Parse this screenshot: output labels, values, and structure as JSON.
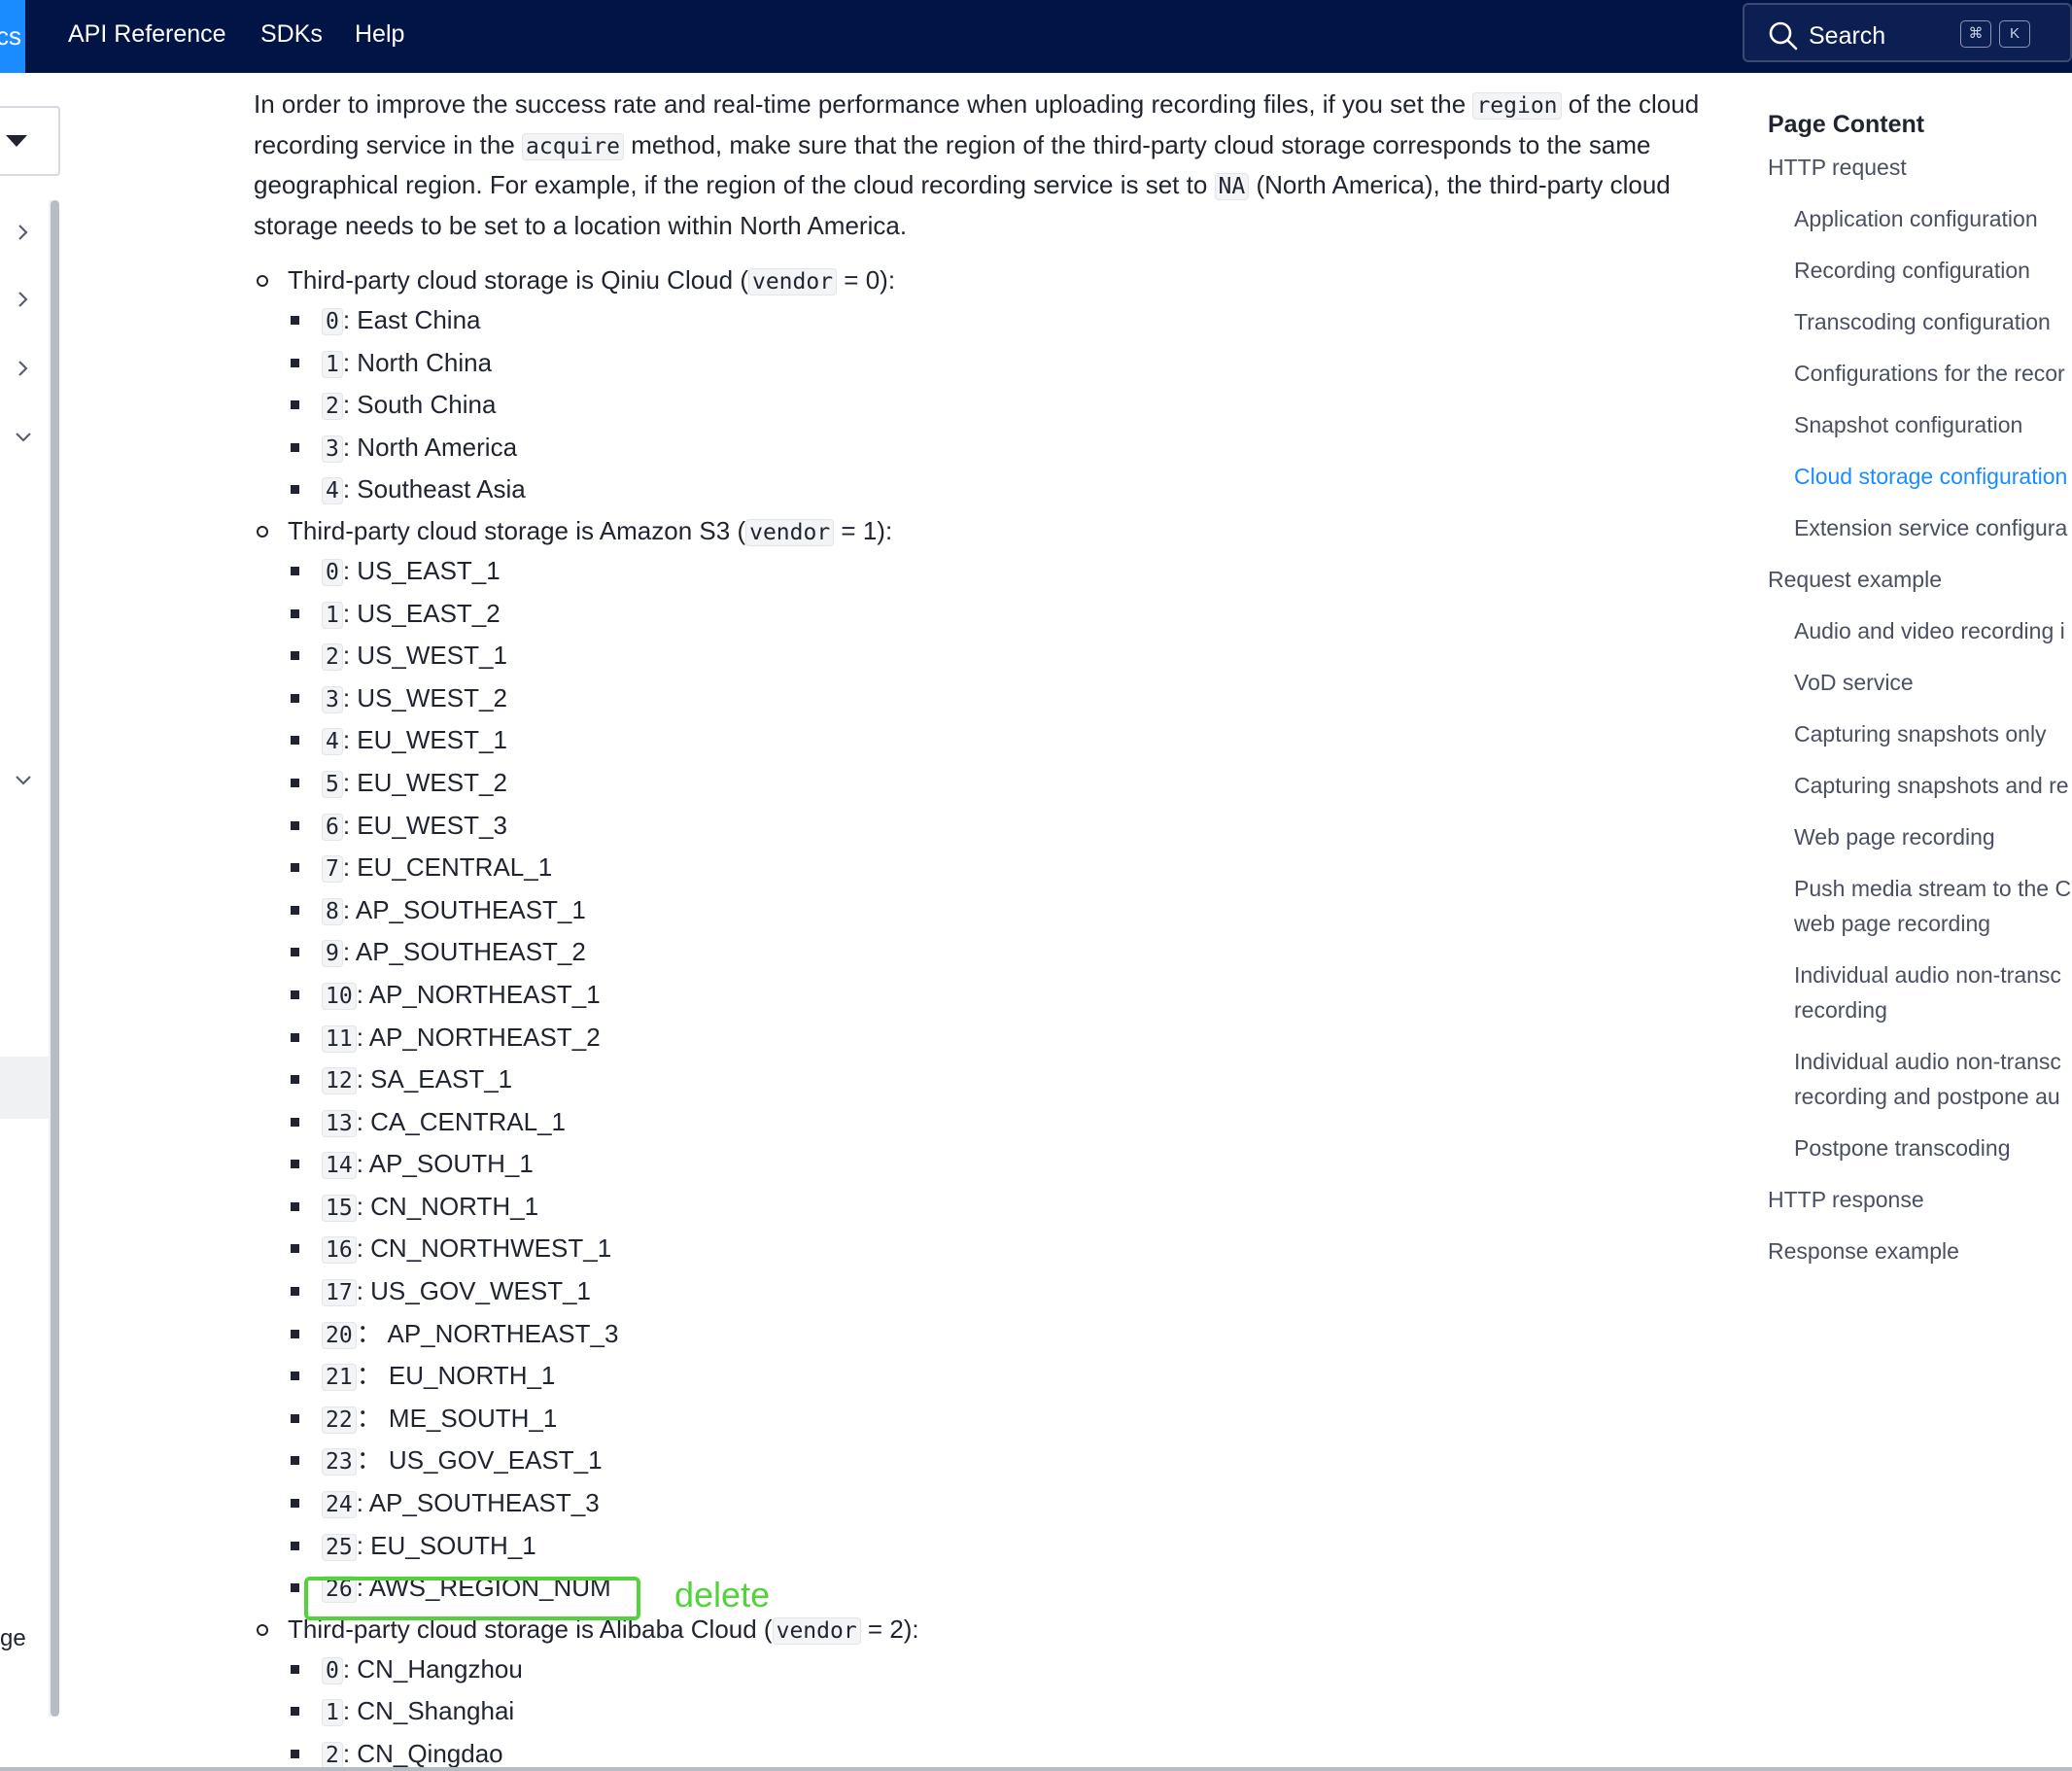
{
  "nav": {
    "brand_fragment": "cs",
    "links": [
      "API Reference",
      "SDKs",
      "Help"
    ],
    "search_label": "Search",
    "shortcut_keys": [
      "⌘",
      "K"
    ]
  },
  "sidebar": {
    "fragment_text": "ge"
  },
  "content": {
    "intro_parts": {
      "p1": "In order to improve the success rate and real-time performance when uploading recording files, if you set the ",
      "c1": "region",
      "p2": " of the cloud recording service in the ",
      "c2": "acquire",
      "p3": " method, make sure that the region of the third-party cloud storage corresponds to the same geographical region. For example, if the region of the cloud recording service is set to ",
      "c3": "NA",
      "p4": " (North America), the third-party cloud storage needs to be set to a location within North America."
    },
    "groups": [
      {
        "prefix": "Third-party cloud storage is Qiniu Cloud (",
        "code": "vendor",
        "suffix": " = 0):",
        "items": [
          {
            "code": "0",
            "label": ": East China"
          },
          {
            "code": "1",
            "label": ": North China"
          },
          {
            "code": "2",
            "label": ": South China"
          },
          {
            "code": "3",
            "label": ": North America"
          },
          {
            "code": "4",
            "label": ": Southeast Asia"
          }
        ]
      },
      {
        "prefix": "Third-party cloud storage is Amazon S3 (",
        "code": "vendor",
        "suffix": " = 1):",
        "items": [
          {
            "code": "0",
            "label": ": US_EAST_1"
          },
          {
            "code": "1",
            "label": ": US_EAST_2"
          },
          {
            "code": "2",
            "label": ": US_WEST_1"
          },
          {
            "code": "3",
            "label": ": US_WEST_2"
          },
          {
            "code": "4",
            "label": ": EU_WEST_1"
          },
          {
            "code": "5",
            "label": ": EU_WEST_2"
          },
          {
            "code": "6",
            "label": ": EU_WEST_3"
          },
          {
            "code": "7",
            "label": ": EU_CENTRAL_1"
          },
          {
            "code": "8",
            "label": ": AP_SOUTHEAST_1"
          },
          {
            "code": "9",
            "label": ": AP_SOUTHEAST_2"
          },
          {
            "code": "10",
            "label": ": AP_NORTHEAST_1"
          },
          {
            "code": "11",
            "label": ": AP_NORTHEAST_2"
          },
          {
            "code": "12",
            "label": ": SA_EAST_1"
          },
          {
            "code": "13",
            "label": ": CA_CENTRAL_1"
          },
          {
            "code": "14",
            "label": ": AP_SOUTH_1"
          },
          {
            "code": "15",
            "label": ": CN_NORTH_1"
          },
          {
            "code": "16",
            "label": ": CN_NORTHWEST_1"
          },
          {
            "code": "17",
            "label": ": US_GOV_WEST_1"
          },
          {
            "code": "20",
            "label": "： AP_NORTHEAST_3"
          },
          {
            "code": "21",
            "label": "： EU_NORTH_1"
          },
          {
            "code": "22",
            "label": "： ME_SOUTH_1"
          },
          {
            "code": "23",
            "label": "： US_GOV_EAST_1"
          },
          {
            "code": "24",
            "label": ": AP_SOUTHEAST_3"
          },
          {
            "code": "25",
            "label": ": EU_SOUTH_1"
          },
          {
            "code": "26",
            "label": ": AWS_REGION_NUM"
          }
        ]
      },
      {
        "prefix": "Third-party cloud storage is Alibaba Cloud (",
        "code": "vendor",
        "suffix": " = 2):",
        "items": [
          {
            "code": "0",
            "label": ": CN_Hangzhou"
          },
          {
            "code": "1",
            "label": ": CN_Shanghai"
          },
          {
            "code": "2",
            "label": ": CN_Qingdao"
          }
        ]
      }
    ],
    "annotation": "delete"
  },
  "toc": {
    "title": "Page Content",
    "items": [
      {
        "label": "HTTP request",
        "level": 1,
        "active": false
      },
      {
        "label": "Application configuration",
        "level": 2,
        "active": false
      },
      {
        "label": "Recording configuration",
        "level": 2,
        "active": false
      },
      {
        "label": "Transcoding configuration",
        "level": 2,
        "active": false
      },
      {
        "label": "Configurations for the recor",
        "level": 2,
        "active": false
      },
      {
        "label": "Snapshot configuration",
        "level": 2,
        "active": false
      },
      {
        "label": "Cloud storage configuration",
        "level": 2,
        "active": true
      },
      {
        "label": "Extension service configura",
        "level": 2,
        "active": false
      },
      {
        "label": "Request example",
        "level": 1,
        "active": false
      },
      {
        "label": "Audio and video recording i",
        "level": 2,
        "active": false
      },
      {
        "label": "VoD service",
        "level": 2,
        "active": false
      },
      {
        "label": "Capturing snapshots only",
        "level": 2,
        "active": false
      },
      {
        "label": "Capturing snapshots and re",
        "level": 2,
        "active": false
      },
      {
        "label": "Web page recording",
        "level": 2,
        "active": false
      },
      {
        "label": "Push media stream to the C",
        "label2": "web page recording",
        "level": 2,
        "active": false
      },
      {
        "label": "Individual audio non-transc",
        "label2": "recording",
        "level": 2,
        "active": false
      },
      {
        "label": "Individual audio non-transc",
        "label2": "recording and postpone au",
        "level": 2,
        "active": false
      },
      {
        "label": "Postpone transcoding",
        "level": 2,
        "active": false
      },
      {
        "label": "HTTP response",
        "level": 1,
        "active": false
      },
      {
        "label": "Response example",
        "level": 1,
        "active": false
      }
    ]
  }
}
